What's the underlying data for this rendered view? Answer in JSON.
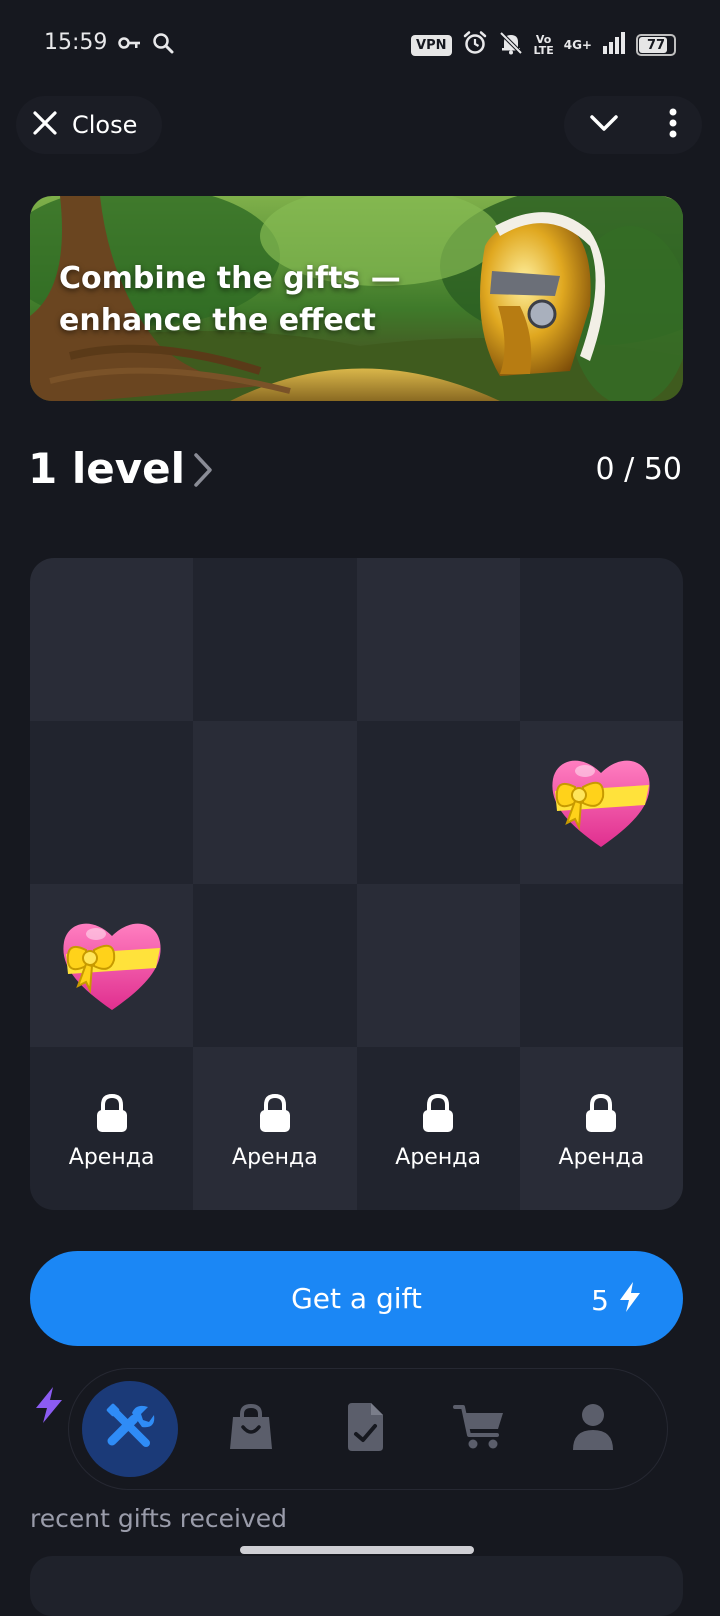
{
  "status_bar": {
    "time": "15:59",
    "vpn_label": "VPN",
    "volte_top": "Vo",
    "volte_bottom": "LTE",
    "network_label": "4G+",
    "battery_level": "77",
    "icons": [
      "key-icon",
      "search-icon",
      "alarm-icon",
      "bell-off-icon",
      "signal-icon"
    ]
  },
  "header": {
    "close_label": "Close",
    "icons": [
      "close-icon",
      "chevron-down-icon",
      "more-vertical-icon"
    ]
  },
  "banner": {
    "title": "Combine the gifts — enhance the effect",
    "image": "spartan-helmet-jungle-illustration"
  },
  "level": {
    "title": "1 level",
    "progress": "0 / 50"
  },
  "grid": {
    "rows": 4,
    "columns": 4,
    "gift_icon": "heart-with-ribbon-icon",
    "gifts_at": [
      {
        "row": 2,
        "col": 4
      },
      {
        "row": 3,
        "col": 1
      }
    ],
    "locked_label": "Аренда",
    "locked_slots": [
      "Аренда",
      "Аренда",
      "Аренда",
      "Аренда"
    ]
  },
  "action": {
    "button_label": "Get a gift",
    "cost": "5",
    "cost_icon": "lightning-icon"
  },
  "tabbar": {
    "items": [
      {
        "name": "tools",
        "icon": "tools-icon",
        "active": true
      },
      {
        "name": "shop",
        "icon": "shopping-bag-icon",
        "active": false
      },
      {
        "name": "tasks",
        "icon": "document-check-icon",
        "active": false
      },
      {
        "name": "cart",
        "icon": "cart-icon",
        "active": false
      },
      {
        "name": "profile",
        "icon": "user-icon",
        "active": false
      }
    ]
  },
  "footer": {
    "recent_label": "recent gifts received"
  },
  "colors": {
    "background": "#16181f",
    "accent": "#1b87f5",
    "tab_active": "#1b3a78",
    "energy": "#8c5cf2",
    "cell_dark": "#21242e",
    "cell_light": "#292c37"
  }
}
